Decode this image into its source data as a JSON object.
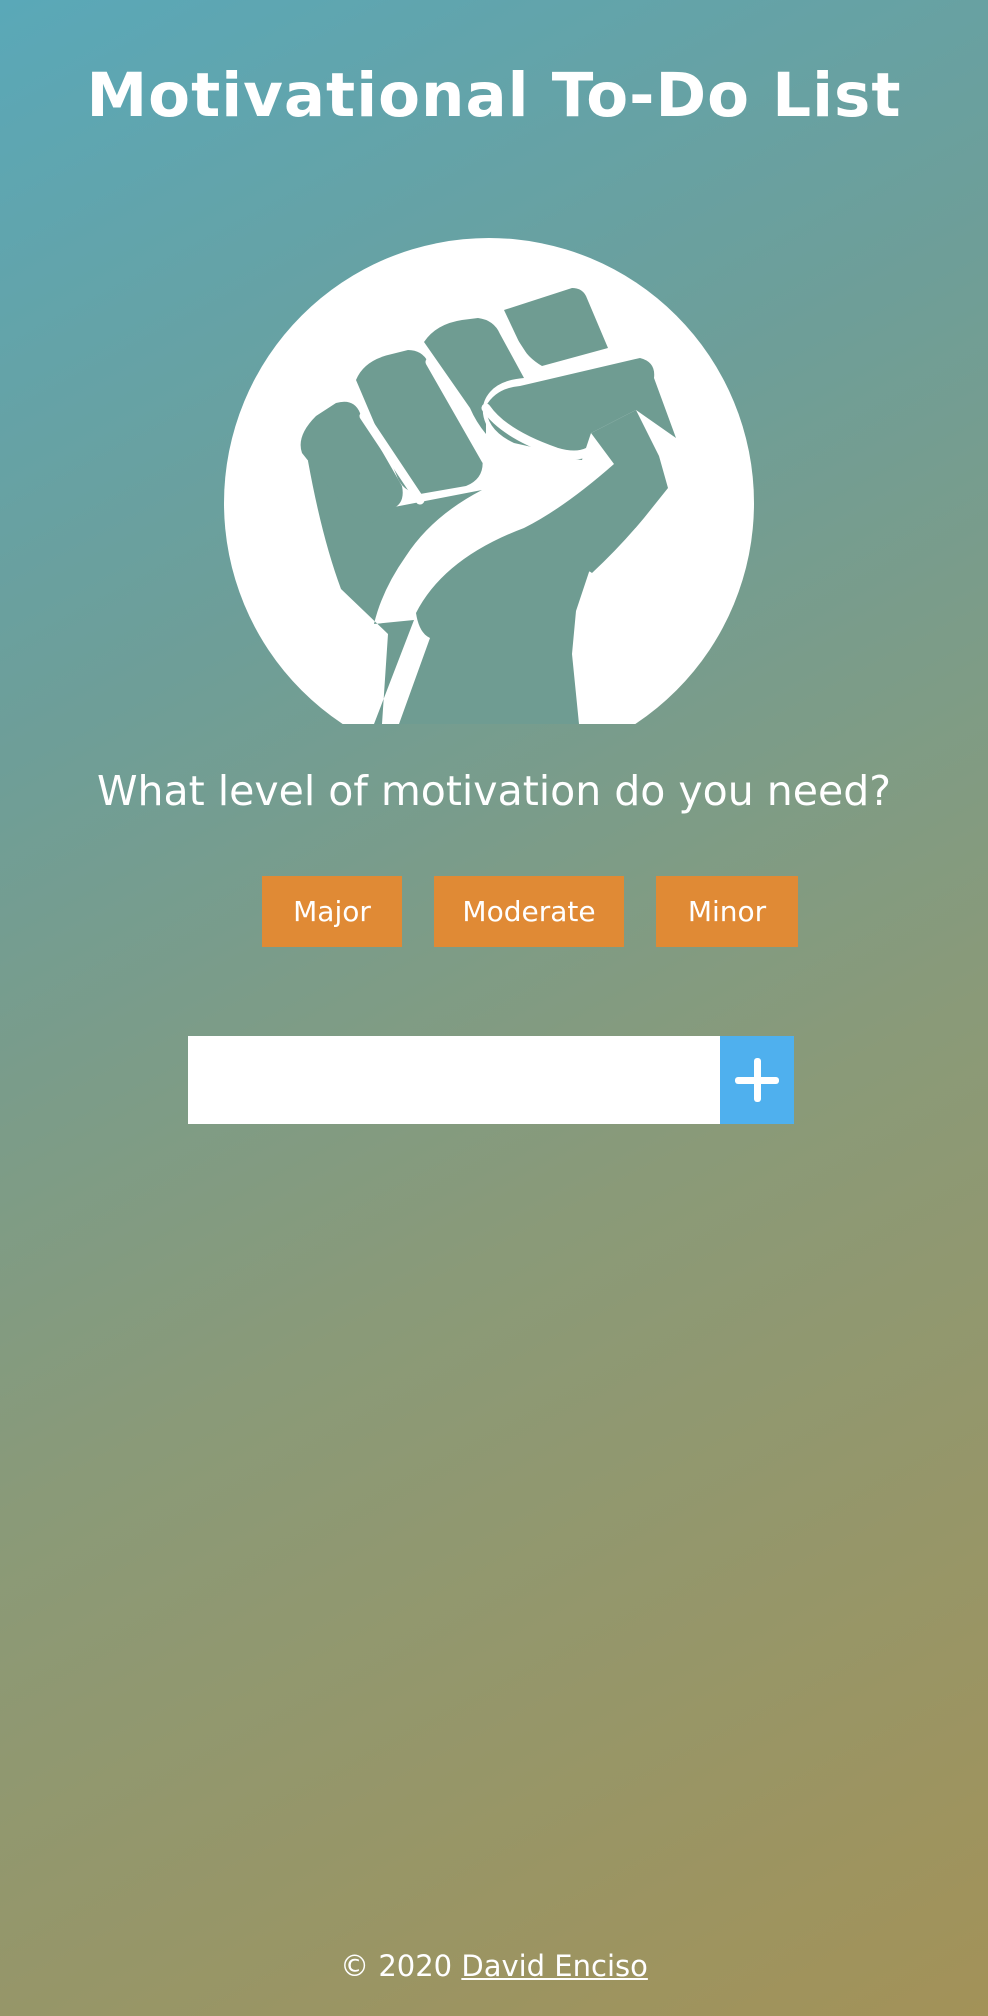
{
  "header": {
    "title": "Motivational To-Do List"
  },
  "hero": {
    "icon": "raised-fist-icon"
  },
  "prompt": {
    "question": "What level of motivation do you need?"
  },
  "levels": {
    "major_label": "Major",
    "moderate_label": "Moderate",
    "minor_label": "Minor",
    "button_color": "#e08a35"
  },
  "todo": {
    "input_value": "",
    "input_placeholder": "",
    "add_icon": "plus-icon",
    "add_button_color": "#4fb0ee"
  },
  "footer": {
    "copyright": "© 2020 ",
    "author_link": "David Enciso"
  },
  "colors": {
    "background_top_left": "#5aa8b8",
    "background_bottom_right": "#a39258",
    "text": "#ffffff"
  }
}
